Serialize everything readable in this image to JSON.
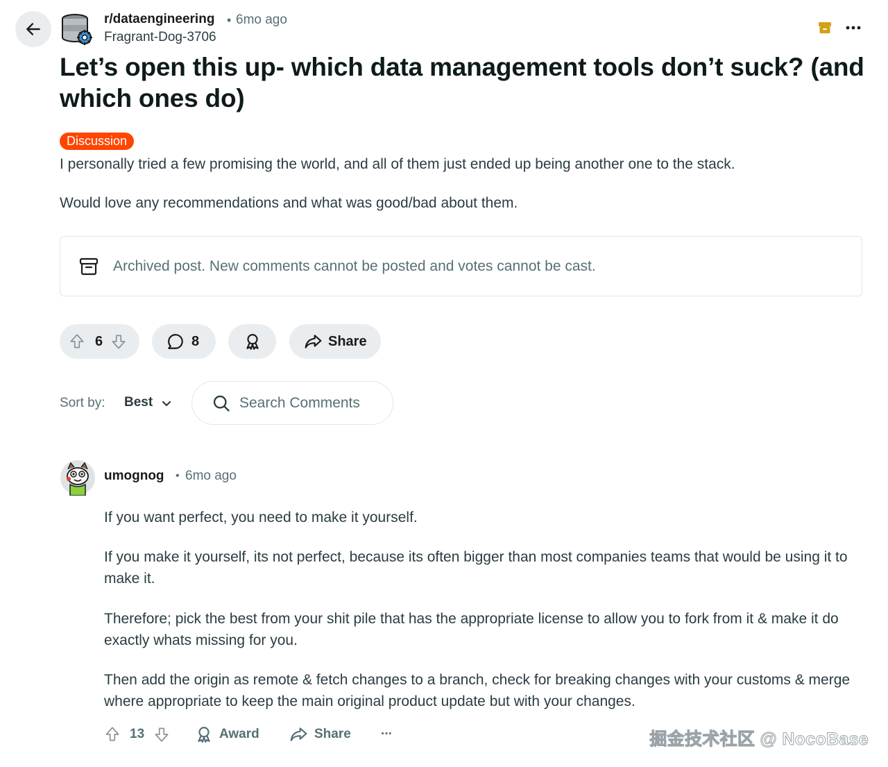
{
  "header": {
    "subreddit": "r/dataengineering",
    "separator": "•",
    "age": "6mo ago",
    "author": "Fragrant-Dog-3706"
  },
  "post": {
    "title": "Let’s open this up- which data management tools don’t suck? (and which ones do)",
    "flair": "Discussion",
    "body": [
      "I personally tried a few promising the world, and all of them just ended up being another one to the stack.",
      "Would love any recommendations and what was good/bad about them."
    ],
    "archived_notice": "Archived post. New comments cannot be posted and votes cannot be cast."
  },
  "actions": {
    "votes": "6",
    "comments": "8",
    "share_label": "Share"
  },
  "sort": {
    "label": "Sort by:",
    "value": "Best",
    "search_placeholder": "Search Comments"
  },
  "comment": {
    "author": "umognog",
    "separator": "•",
    "age": "6mo ago",
    "paragraphs": [
      "If you want perfect, you need to make it yourself.",
      "If you make it yourself, its not perfect, because its often bigger than most companies teams that would be using it to make it.",
      "Therefore; pick the best from your shit pile that has the appropriate license to allow you to fork from it & make it do exactly whats missing for you.",
      "Then add the origin as remote & fetch changes to a branch, check for breaking changes with your customs & merge where appropriate to keep the main original product update but with your changes."
    ],
    "votes": "13",
    "award_label": "Award",
    "share_label": "Share",
    "more_label": "···"
  },
  "watermark": "掘金技术社区 @ NocoBase",
  "colors": {
    "flair_bg": "#ff4500",
    "pill_bg": "#eaedef",
    "muted_text": "#576f76",
    "archive_icon": "#d4a017"
  },
  "icons": [
    "back-arrow-icon",
    "subreddit-icon",
    "archive-icon",
    "more-icon",
    "upvote-icon",
    "downvote-icon",
    "comment-icon",
    "award-icon",
    "share-icon",
    "chevron-down-icon",
    "search-icon"
  ]
}
